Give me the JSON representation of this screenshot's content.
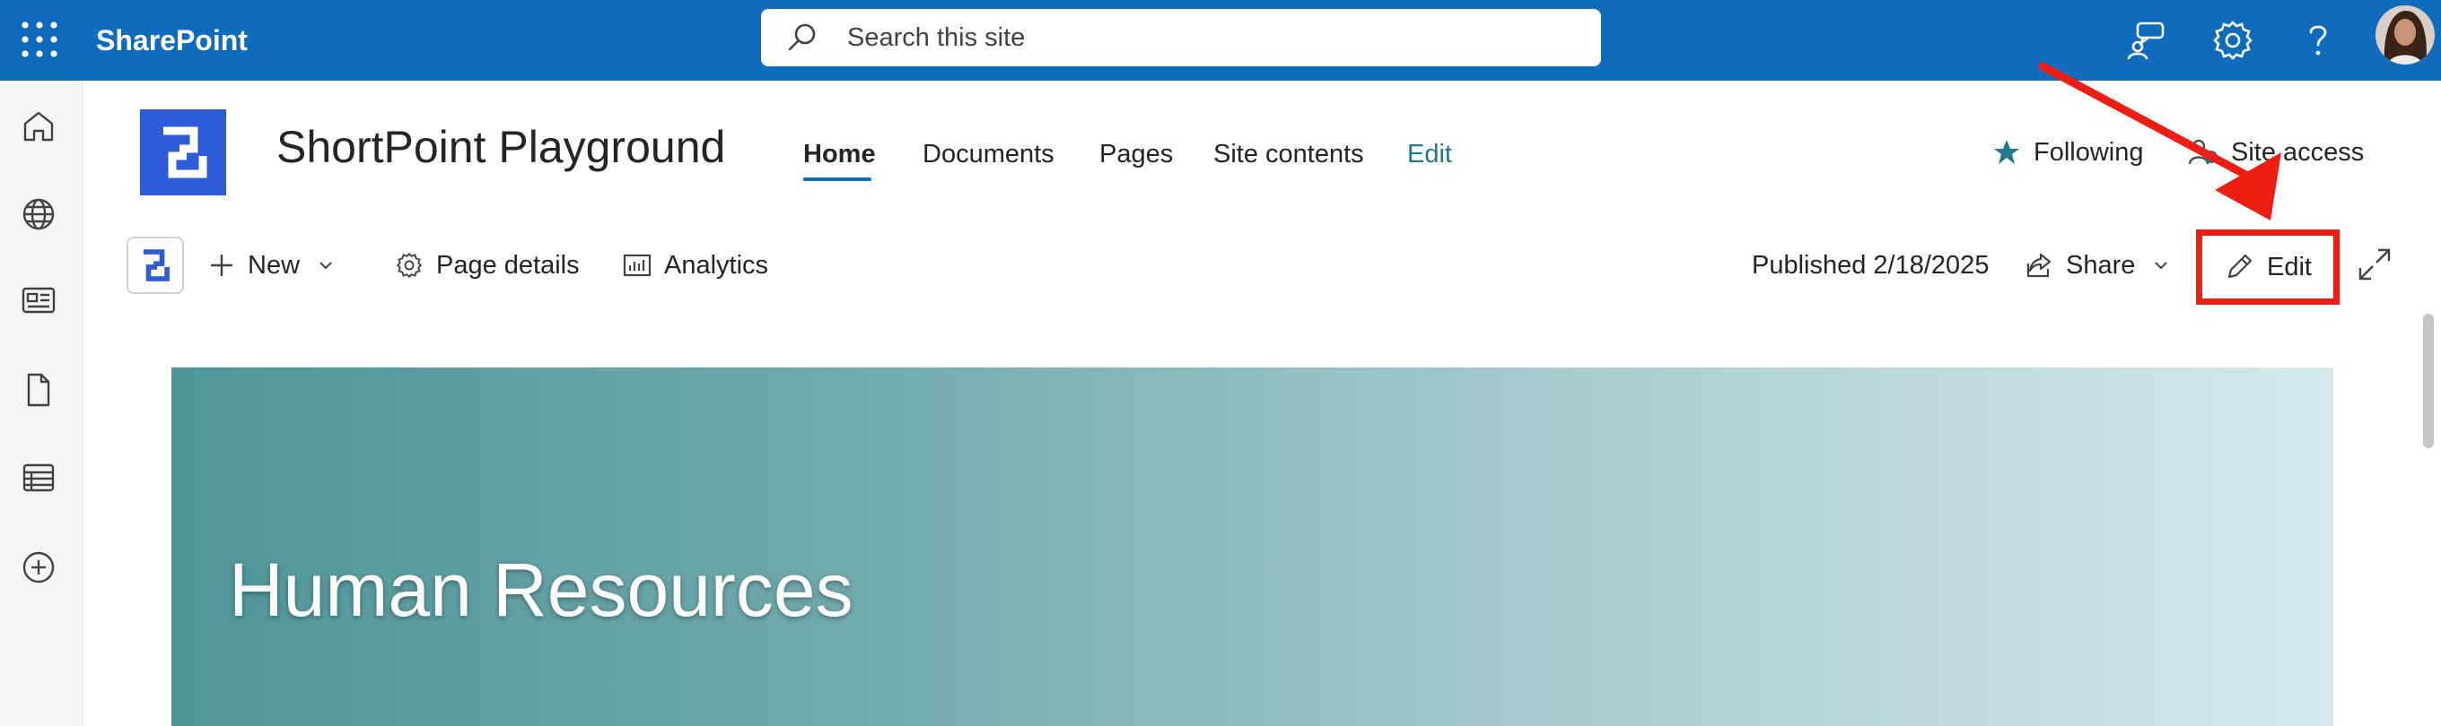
{
  "suite": {
    "app_name": "SharePoint",
    "search_placeholder": "Search this site",
    "icons": [
      "waffle-icon",
      "feedback-icon",
      "settings-icon",
      "help-icon",
      "avatar"
    ]
  },
  "rail": {
    "icons": [
      "home-icon",
      "globe-icon",
      "news-icon",
      "document-icon",
      "list-icon",
      "add-icon"
    ]
  },
  "site": {
    "title": "ShortPoint Playground",
    "nav": [
      "Home",
      "Documents",
      "Pages",
      "Site contents",
      "Edit"
    ],
    "following_label": "Following",
    "site_access_label": "Site access"
  },
  "command_bar": {
    "new_label": "New",
    "page_details_label": "Page details",
    "analytics_label": "Analytics",
    "published": "Published 2/18/2025",
    "share_label": "Share",
    "edit_label": "Edit"
  },
  "hero": {
    "title": "Human Resources"
  },
  "colors": {
    "suite_bar": "#0f6cbd",
    "accent": "#1f7a8c",
    "highlight": "#ef1d12",
    "site_logo": "#2e5bd8"
  }
}
